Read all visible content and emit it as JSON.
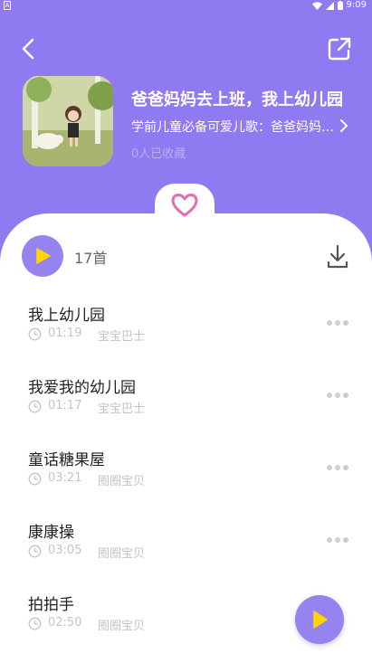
{
  "status_bar": {
    "time": "9:09"
  },
  "album": {
    "title": "爸爸妈妈去上班，我上幼儿园",
    "description": "学前儿童必备可爱儿歌：爸爸妈妈去上班，我上幼儿园",
    "collect_count": "0人已收藏"
  },
  "track_count": "17首",
  "tracks": [
    {
      "name": "我上幼儿园",
      "duration": "01:19",
      "artist": "宝宝巴士"
    },
    {
      "name": "我爱我的幼儿园",
      "duration": "01:17",
      "artist": "宝宝巴士"
    },
    {
      "name": "童话糖果屋",
      "duration": "03:21",
      "artist": "圈圈宝贝"
    },
    {
      "name": "康康操",
      "duration": "03:05",
      "artist": "圈圈宝贝"
    },
    {
      "name": "拍拍手",
      "duration": "02:50",
      "artist": "圈圈宝贝"
    }
  ],
  "icons": {
    "back": "chevron-left-icon",
    "share": "external-link-icon",
    "favorite": "heart-icon",
    "play": "play-icon",
    "download": "download-icon",
    "more": "more-dots-icon",
    "clock": "clock-icon"
  },
  "colors": {
    "header_bg": "#8f7af1",
    "accent": "#9783f0",
    "play_triangle": "#ffd700",
    "heart": "#e86ab0"
  }
}
